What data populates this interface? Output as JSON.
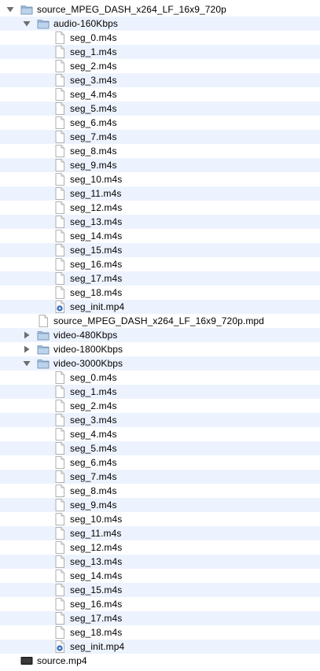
{
  "tree": [
    {
      "label": "source_MPEG_DASH_x264_LF_16x9_720p",
      "kind": "folder",
      "depth": 0,
      "expanded": true
    },
    {
      "label": "audio-160Kbps",
      "kind": "folder",
      "depth": 1,
      "expanded": true
    },
    {
      "label": "seg_0.m4s",
      "kind": "doc",
      "depth": 2
    },
    {
      "label": "seg_1.m4s",
      "kind": "doc",
      "depth": 2
    },
    {
      "label": "seg_2.m4s",
      "kind": "doc",
      "depth": 2
    },
    {
      "label": "seg_3.m4s",
      "kind": "doc",
      "depth": 2
    },
    {
      "label": "seg_4.m4s",
      "kind": "doc",
      "depth": 2
    },
    {
      "label": "seg_5.m4s",
      "kind": "doc",
      "depth": 2
    },
    {
      "label": "seg_6.m4s",
      "kind": "doc",
      "depth": 2
    },
    {
      "label": "seg_7.m4s",
      "kind": "doc",
      "depth": 2
    },
    {
      "label": "seg_8.m4s",
      "kind": "doc",
      "depth": 2
    },
    {
      "label": "seg_9.m4s",
      "kind": "doc",
      "depth": 2
    },
    {
      "label": "seg_10.m4s",
      "kind": "doc",
      "depth": 2
    },
    {
      "label": "seg_11.m4s",
      "kind": "doc",
      "depth": 2
    },
    {
      "label": "seg_12.m4s",
      "kind": "doc",
      "depth": 2
    },
    {
      "label": "seg_13.m4s",
      "kind": "doc",
      "depth": 2
    },
    {
      "label": "seg_14.m4s",
      "kind": "doc",
      "depth": 2
    },
    {
      "label": "seg_15.m4s",
      "kind": "doc",
      "depth": 2
    },
    {
      "label": "seg_16.m4s",
      "kind": "doc",
      "depth": 2
    },
    {
      "label": "seg_17.m4s",
      "kind": "doc",
      "depth": 2
    },
    {
      "label": "seg_18.m4s",
      "kind": "doc",
      "depth": 2
    },
    {
      "label": "seg_init.mp4",
      "kind": "mp4",
      "depth": 2
    },
    {
      "label": "source_MPEG_DASH_x264_LF_16x9_720p.mpd",
      "kind": "doc",
      "depth": 1
    },
    {
      "label": "video-480Kbps",
      "kind": "folder",
      "depth": 1,
      "expanded": false
    },
    {
      "label": "video-1800Kbps",
      "kind": "folder",
      "depth": 1,
      "expanded": false
    },
    {
      "label": "video-3000Kbps",
      "kind": "folder",
      "depth": 1,
      "expanded": true
    },
    {
      "label": "seg_0.m4s",
      "kind": "doc",
      "depth": 2
    },
    {
      "label": "seg_1.m4s",
      "kind": "doc",
      "depth": 2
    },
    {
      "label": "seg_2.m4s",
      "kind": "doc",
      "depth": 2
    },
    {
      "label": "seg_3.m4s",
      "kind": "doc",
      "depth": 2
    },
    {
      "label": "seg_4.m4s",
      "kind": "doc",
      "depth": 2
    },
    {
      "label": "seg_5.m4s",
      "kind": "doc",
      "depth": 2
    },
    {
      "label": "seg_6.m4s",
      "kind": "doc",
      "depth": 2
    },
    {
      "label": "seg_7.m4s",
      "kind": "doc",
      "depth": 2
    },
    {
      "label": "seg_8.m4s",
      "kind": "doc",
      "depth": 2
    },
    {
      "label": "seg_9.m4s",
      "kind": "doc",
      "depth": 2
    },
    {
      "label": "seg_10.m4s",
      "kind": "doc",
      "depth": 2
    },
    {
      "label": "seg_11.m4s",
      "kind": "doc",
      "depth": 2
    },
    {
      "label": "seg_12.m4s",
      "kind": "doc",
      "depth": 2
    },
    {
      "label": "seg_13.m4s",
      "kind": "doc",
      "depth": 2
    },
    {
      "label": "seg_14.m4s",
      "kind": "doc",
      "depth": 2
    },
    {
      "label": "seg_15.m4s",
      "kind": "doc",
      "depth": 2
    },
    {
      "label": "seg_16.m4s",
      "kind": "doc",
      "depth": 2
    },
    {
      "label": "seg_17.m4s",
      "kind": "doc",
      "depth": 2
    },
    {
      "label": "seg_18.m4s",
      "kind": "doc",
      "depth": 2
    },
    {
      "label": "seg_init.mp4",
      "kind": "mp4",
      "depth": 2
    },
    {
      "label": "source.mp4",
      "kind": "movie",
      "depth": 0
    }
  ],
  "icons": {
    "folder": "folder-icon",
    "doc": "document-icon",
    "mp4": "quicktime-movie-icon",
    "movie": "movie-file-icon",
    "expanded": "disclosure-triangle-down-icon",
    "collapsed": "disclosure-triangle-right-icon"
  },
  "colors": {
    "row_alternate": "#edf3fe",
    "folder_fill": "#a8c3e0",
    "folder_stroke": "#6f8fb3",
    "disclosure": "#6e6e6e"
  }
}
